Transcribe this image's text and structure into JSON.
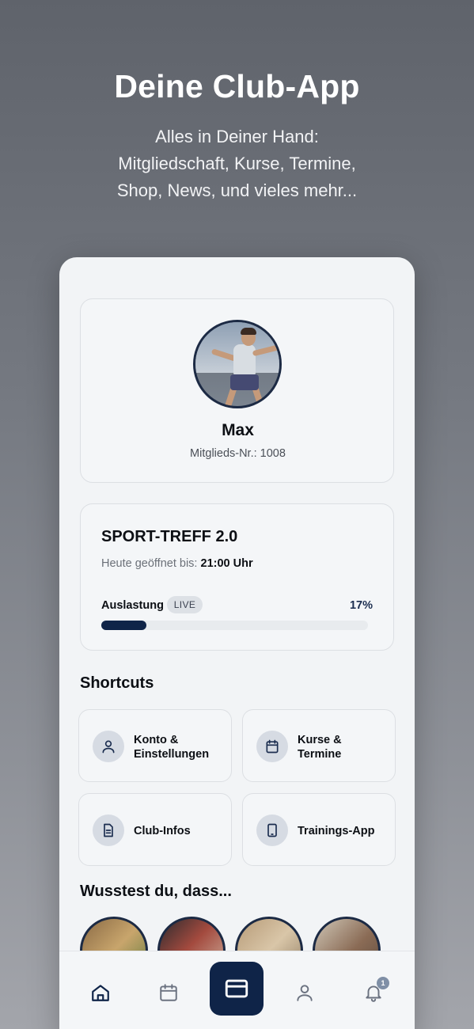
{
  "hero": {
    "title": "Deine Club-App",
    "subtitle_lines": [
      "Alles in Deiner Hand:",
      "Mitgliedschaft, Kurse, Termine,",
      "Shop, News, und vieles mehr..."
    ]
  },
  "profile": {
    "name": "Max",
    "member_no": "Mitglieds-Nr.: 1008"
  },
  "club": {
    "name": "SPORT-TREFF 2.0",
    "hours_label": "Heute geöffnet bis:",
    "hours_value": "21:00 Uhr",
    "load_label": "Auslastung",
    "live_badge": "LIVE",
    "load_percent_text": "17%",
    "load_fraction": 0.17
  },
  "shortcuts": {
    "title": "Shortcuts",
    "items": [
      {
        "label_line1": "Konto &",
        "label_line2": "Einstellungen",
        "icon": "user-icon"
      },
      {
        "label_line1": "Kurse &",
        "label_line2": "Termine",
        "icon": "calendar-icon"
      },
      {
        "label_line1": "Club-Infos",
        "label_line2": "",
        "icon": "document-icon"
      },
      {
        "label_line1": "Trainings-App",
        "label_line2": "",
        "icon": "tablet-icon"
      }
    ]
  },
  "did_you_know": {
    "title": "Wusstest du, dass..."
  },
  "tabbar": {
    "items": [
      "home-icon",
      "calendar-icon",
      "card-icon",
      "user-icon",
      "bell-icon"
    ],
    "notification_count": "1"
  },
  "colors": {
    "accent": "#0f2448",
    "card_bg": "#f4f6f8",
    "icon_circle": "#d6dbe3"
  }
}
